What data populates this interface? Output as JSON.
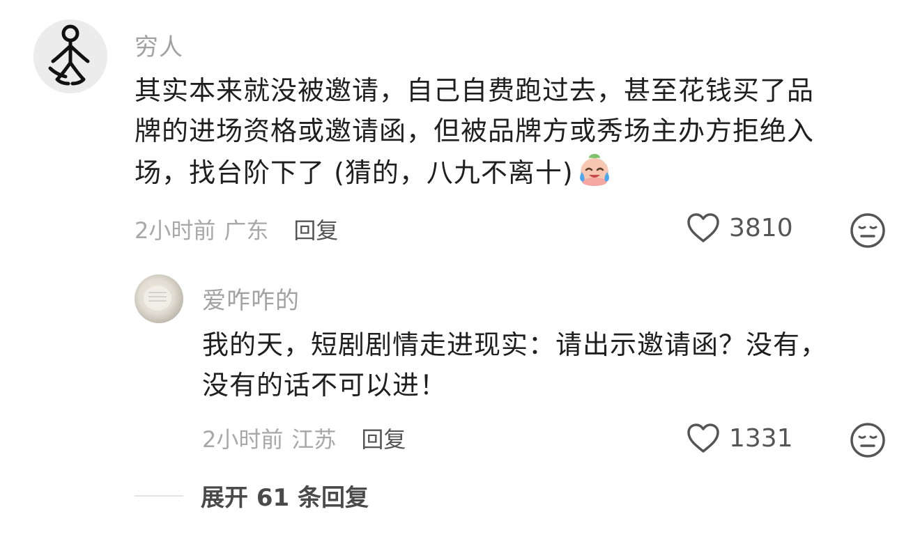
{
  "comment": {
    "username": "穷人",
    "text_lines": [
      "其实本来就没被邀请，自己自费跑过去，甚至花钱买了品",
      "牌的进场资格或邀请函，但被品牌方或秀场主办方拒绝入",
      "场，找台阶下了 (猜的，八九不离十)"
    ],
    "emoji": "crying-laughing-emoji",
    "time": "2小时前",
    "location": "广东",
    "reply_label": "回复",
    "likes": "3810",
    "avatar_icon": "stick-figure-icon"
  },
  "reply": {
    "username": "爱咋咋的",
    "text_lines": [
      "我的天，短剧剧情走进现实：请出示邀请函？没有，",
      "没有的话不可以进！"
    ],
    "time": "2小时前",
    "location": "江苏",
    "reply_label": "回复",
    "likes": "1331"
  },
  "expand": {
    "label": "展开 61 条回复"
  },
  "colors": {
    "username": "#a2a2a2",
    "text": "#1f1f1f",
    "meta": "#a8a8a8",
    "action": "#555555"
  }
}
